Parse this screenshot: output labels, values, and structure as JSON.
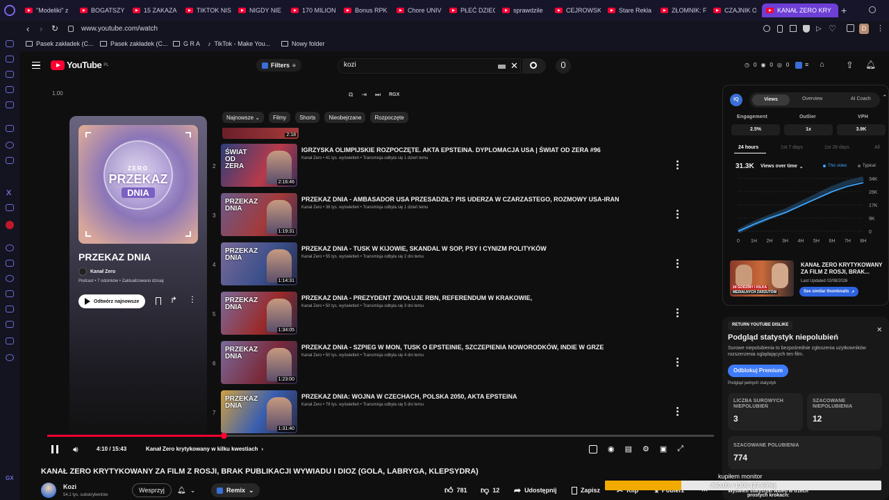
{
  "browser": {
    "tabs": [
      {
        "label": "\"Modeliki\" z"
      },
      {
        "label": "BOGATSZY"
      },
      {
        "label": "15 ZAKAZA"
      },
      {
        "label": "TIKTOK NIS"
      },
      {
        "label": "NIGDY NIE"
      },
      {
        "label": "170 MILION"
      },
      {
        "label": "Bonus RPK"
      },
      {
        "label": "Chore UNIV"
      },
      {
        "label": "PŁEĆ DZIEC"
      },
      {
        "label": "sprawdzile"
      },
      {
        "label": "CEJROWSK"
      },
      {
        "label": "Stare Rekla"
      },
      {
        "label": "ZŁOMNIK: F"
      },
      {
        "label": "CZAJNIK O"
      },
      {
        "label": "KANAŁ ZERO KRY"
      }
    ],
    "url": "www.youtube.com/watch",
    "profile_initial": "D",
    "bookmarks": [
      {
        "label": "Pasek zakładek (C..."
      },
      {
        "label": "Pasek zakładek (C..."
      },
      {
        "label": "G R A"
      },
      {
        "label": "TikTok - Make You..."
      },
      {
        "label": "Nowy folder"
      }
    ]
  },
  "youtube": {
    "logo": "YouTube",
    "logo_country": "PL",
    "filters_label": "Filters",
    "search_value": "kozi",
    "header_counts": [
      "0",
      "0",
      "0"
    ],
    "speed": "1.00",
    "rgx_label": "RGX"
  },
  "playlist": {
    "title": "PRZEKAZ DNIA",
    "cover_top": "ZERO",
    "cover_big": "PRZEKAZ",
    "cover_dnia": "DNIA",
    "channel": "Kanał Zero",
    "meta": "Podcast • 7 odcinków • Zaktualizowano dzisiaj",
    "play_label": "Odtwórz najnowsze"
  },
  "chips": [
    "Najnowsze",
    "Filmy",
    "Shorts",
    "Nieobejrzane",
    "Rozpoczęte"
  ],
  "top_partial_duration": "2:18",
  "videos": [
    {
      "num": "2",
      "title": "IGRZYSKA OLIMPIJSKIE ROZPOCZĘTE. AKTA EPSTEINA. DYPLOMACJA USA | ŚWIAT OD ZERA #96",
      "meta": "Kanał Zero • 41 tys. wyświetleń • Transmisja odbyła się 1 dzień temu",
      "duration": "2:16:46",
      "thumb_text": "ŚWIAT OD ZERA"
    },
    {
      "num": "3",
      "title": "PRZEKAZ DNIA - AMBASADOR USA PRZESADZIŁ? PIS UDERZA W CZARZASTEGO, ROZMOWY USA-IRAN",
      "meta": "Kanał Zero • 36 tys. wyświetleń • Transmisja odbyła się 1 dzień temu",
      "duration": "1:19:31",
      "thumb_text": "PRZEKAZ DNIA"
    },
    {
      "num": "4",
      "title": "PRZEKAZ DNIA - TUSK W KIJOWIE, SKANDAL W SOP, PSY I CYNIZM POLITYKÓW",
      "meta": "Kanał Zero • 55 tys. wyświetleń • Transmisja odbyła się 2 dni temu",
      "duration": "1:14:31",
      "thumb_text": "PRZEKAZ DNIA"
    },
    {
      "num": "5",
      "title": "PRZEKAZ DNIA - PREZYDENT ZWOŁUJE RBN, REFERENDUM W KRAKOWIE,",
      "meta": "Kanał Zero • 50 tys. wyświetleń • Transmisja odbyła się 3 dni temu",
      "duration": "1:34:05",
      "thumb_text": "PRZEKAZ DNIA"
    },
    {
      "num": "6",
      "title": "PRZEKAZ DNIA - SZPIEG W MON, TUSK O EPSTEINIE, SZCZEPIENIA NOWORODKÓW, INDIE W GRZE",
      "meta": "Kanał Zero • 50 tys. wyświetleń • Transmisja odbyła się 4 dni temu",
      "duration": "1:23:00",
      "thumb_text": "PRZEKAZ DNIA"
    },
    {
      "num": "7",
      "title": "PRZEKAZ DNIA: WOJNA W CZECHACH, POLSKA 2050, AKTA EPSTEINA",
      "meta": "Kanał Zero • 79 tys. wyświetleń • Transmisja odbyła się 5 dni temu",
      "duration": "1:31:40",
      "thumb_text": "PRZEKAZ DNIA"
    }
  ],
  "player": {
    "time": "4:10 / 15:43",
    "chapter": "Kanał Zero krytykowany w kilku kwestiach",
    "progress": 0.265
  },
  "video": {
    "title": "KANAŁ ZERO KRYTYKOWANY ZA FILM Z ROSJI, BRAK PUBLIKACJI WYWIADU I DIOZ (GOLA, LABRYGA, KLEPSYDRA)",
    "channel": "Kozi",
    "subscribers": "54,1 tys. subskrybentów",
    "support_label": "Wesprzyj",
    "remix_label": "Remix",
    "likes": "781",
    "dislikes": "12",
    "share_label": "Udostępnij",
    "save_label": "Zapisz",
    "clip_label": "Klip",
    "download_label": "Pobierz"
  },
  "vidiq": {
    "tabs": [
      "Views",
      "Overview",
      "AI Coach"
    ],
    "stats_labels": [
      "Engagement",
      "Outlier",
      "VPH"
    ],
    "stats_values": [
      "2.5%",
      "1x",
      "3.9K"
    ],
    "ranges": [
      "24 hours",
      "1st 7 days",
      "1st 28 days",
      "All"
    ],
    "views": "31.3K",
    "views_label": "Views over time",
    "legend_this": "This video",
    "legend_typical": "Typical",
    "yticks": [
      "34K",
      "26K",
      "17K",
      "9K",
      "0"
    ],
    "xticks": [
      "0",
      "1H",
      "2H",
      "3H",
      "4H",
      "5H",
      "6H",
      "7H",
      "8H"
    ],
    "similar_title_1": "KANAŁ ZERO KRYTYKOWANY",
    "similar_title_2": "ZA FILM Z ROSJI, BRAK...",
    "similar_updated": "Last Updated 02/08/2026",
    "similar_button": "See similar thumbnails",
    "thumb_caption_1": "24 GODZINY I KILKA",
    "thumb_caption_2": "MEDIALNYCH ZARZUTÓW"
  },
  "ryd": {
    "badge": "RETURN YOUTUBE DISLIKE",
    "title": "Podgląd statystyk niepolubień",
    "desc": "Surowe niepolubienia to bezpośrednie zgłoszenia użytkowników rozszerzenia oglądających ten film.",
    "button": "Odblokuj Premium",
    "sub": "Podgląd pełnych statystyk",
    "raw_label": "LICZBA SUROWYCH NIEPOLUBIEŃ",
    "raw_value": "3",
    "est_dislikes_label": "SZACOWANE NIEPOLUBIENIA",
    "est_dislikes_value": "12",
    "est_likes_label": "SZACOWANE POLUBIENIA",
    "est_likes_value": "774"
  },
  "overlay": {
    "label": "kupiłem monitor",
    "progress_text": "360.00 / 1300 (27.69%)",
    "progress": 0.2769,
    "footer_1": "Wyświetl statystyki wideo w trzech",
    "footer_2": "prostych krokach:"
  },
  "colors": {
    "accent": "#3ea6ff",
    "red": "#ff0033",
    "purple": "#6d3fd6",
    "overlay": "#f2a900"
  }
}
